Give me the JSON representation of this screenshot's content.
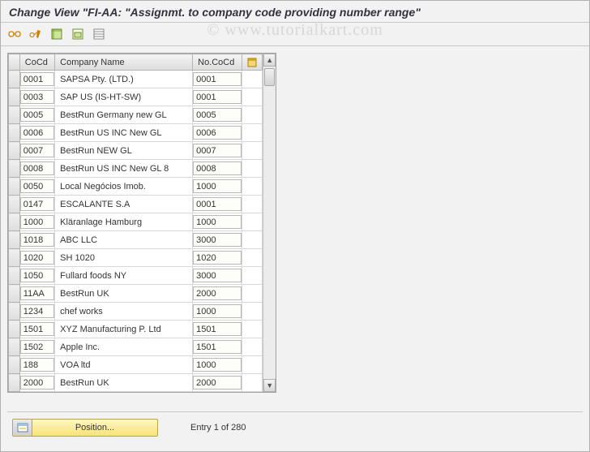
{
  "title": "Change View \"FI-AA: \"Assignmt. to company code providing number range\"",
  "watermark": "© www.tutorialkart.com",
  "toolbar": {
    "other_view": "other-view",
    "change": "change",
    "select_all": "select-all",
    "save": "save",
    "deselect": "deselect"
  },
  "grid": {
    "headers": {
      "cocd": "CoCd",
      "company_name": "Company Name",
      "no_cocd": "No.CoCd"
    },
    "rows": [
      {
        "cocd": "0001",
        "name": "SAPSA Pty. (LTD.)",
        "nococd": "0001"
      },
      {
        "cocd": "0003",
        "name": "SAP US (IS-HT-SW)",
        "nococd": "0001"
      },
      {
        "cocd": "0005",
        "name": "BestRun Germany new GL",
        "nococd": "0005"
      },
      {
        "cocd": "0006",
        "name": "BestRun US INC New GL",
        "nococd": "0006"
      },
      {
        "cocd": "0007",
        "name": "BestRun NEW GL",
        "nococd": "0007"
      },
      {
        "cocd": "0008",
        "name": "BestRun US INC New GL 8",
        "nococd": "0008"
      },
      {
        "cocd": "0050",
        "name": "Local Negócios Imob.",
        "nococd": "1000"
      },
      {
        "cocd": "0147",
        "name": "ESCALANTE S.A",
        "nococd": "0001"
      },
      {
        "cocd": "1000",
        "name": "Kläranlage Hamburg",
        "nococd": "1000"
      },
      {
        "cocd": "1018",
        "name": "ABC LLC",
        "nococd": "3000"
      },
      {
        "cocd": "1020",
        "name": "SH 1020",
        "nococd": "1020"
      },
      {
        "cocd": "1050",
        "name": "Fullard foods NY",
        "nococd": "3000"
      },
      {
        "cocd": "11AA",
        "name": "BestRun UK",
        "nococd": "2000"
      },
      {
        "cocd": "1234",
        "name": "chef works",
        "nococd": "1000"
      },
      {
        "cocd": "1501",
        "name": "XYZ Manufacturing P. Ltd",
        "nococd": "1501"
      },
      {
        "cocd": "1502",
        "name": "Apple Inc.",
        "nococd": "1501"
      },
      {
        "cocd": "188",
        "name": "VOA ltd",
        "nococd": "1000"
      },
      {
        "cocd": "2000",
        "name": "BestRun UK",
        "nococd": "2000"
      }
    ]
  },
  "footer": {
    "position_label": "Position...",
    "entry_text": "Entry 1 of 280"
  }
}
